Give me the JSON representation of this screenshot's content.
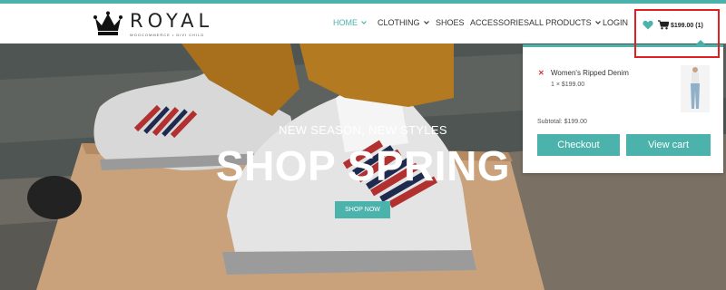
{
  "brand": {
    "name": "ROYAL",
    "tagline": "WooCommerce • Divi Child"
  },
  "nav": {
    "items": [
      {
        "label": "HOME",
        "has_dropdown": true,
        "active": true
      },
      {
        "label": "CLOTHING",
        "has_dropdown": true,
        "active": false
      },
      {
        "label": "SHOES",
        "has_dropdown": false,
        "active": false
      },
      {
        "label": "ACCESSORIES",
        "has_dropdown": false,
        "active": false
      },
      {
        "label": "ALL PRODUCTS",
        "has_dropdown": true,
        "active": false
      },
      {
        "label": "LOGIN",
        "has_dropdown": false,
        "active": false
      }
    ]
  },
  "header_icons": {
    "wishlist": "heart-icon",
    "cart": "cart-icon",
    "cart_total": "$199.00 (1)"
  },
  "hero": {
    "kicker": "NEW SEASON, NEW STYLES",
    "title": "SHOP SPRING",
    "button": "SHOP NOW"
  },
  "cart_dropdown": {
    "items": [
      {
        "name": "Women's Ripped Denim",
        "qty_price": "1 × $199.00"
      }
    ],
    "subtotal": "Subtotal: $199.00",
    "checkout_label": "Checkout",
    "view_cart_label": "View cart"
  },
  "colors": {
    "accent": "#4bb3ac",
    "highlight": "#e02020"
  }
}
